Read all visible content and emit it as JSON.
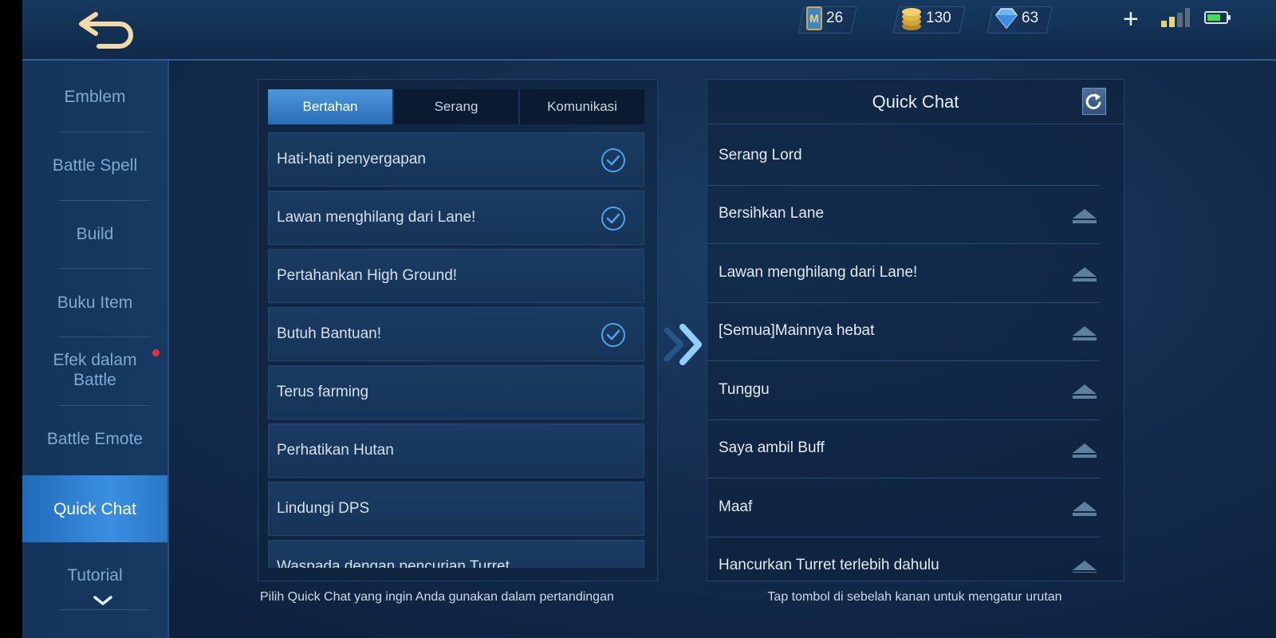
{
  "currencies": [
    {
      "icon": "ticket-icon",
      "value": "26"
    },
    {
      "icon": "gold-coin-icon",
      "value": "130"
    },
    {
      "icon": "diamond-icon",
      "value": "63"
    }
  ],
  "sidebar": {
    "items": [
      {
        "label": "Emblem"
      },
      {
        "label": "Battle Spell"
      },
      {
        "label": "Build"
      },
      {
        "label": "Buku Item"
      },
      {
        "label": "Efek dalam\nBattle",
        "badge": true
      },
      {
        "label": "Battle Emote"
      },
      {
        "label": "Quick Chat",
        "active": true
      },
      {
        "label": "Tutorial"
      }
    ]
  },
  "tabs": [
    {
      "label": "Bertahan",
      "active": true
    },
    {
      "label": "Serang"
    },
    {
      "label": "Komunikasi"
    }
  ],
  "options": [
    {
      "text": "Hati-hati penyergapan",
      "checked": true
    },
    {
      "text": "Lawan menghilang dari Lane!",
      "checked": true
    },
    {
      "text": "Pertahankan High Ground!",
      "checked": false
    },
    {
      "text": "Butuh Bantuan!",
      "checked": true
    },
    {
      "text": "Terus farming",
      "checked": false
    },
    {
      "text": "Perhatikan Hutan",
      "checked": false
    },
    {
      "text": "Lindungi DPS",
      "checked": false
    },
    {
      "text": "Waspada dengan pencurian Turret",
      "checked": false
    }
  ],
  "options_hint": "Pilih Quick Chat yang ingin Anda gunakan dalam pertandingan",
  "quick_chat": {
    "title": "Quick Chat",
    "items": [
      {
        "text": "Serang Lord"
      },
      {
        "text": "Bersihkan Lane"
      },
      {
        "text": "Lawan menghilang dari Lane!"
      },
      {
        "text": "[Semua]Mainnya hebat"
      },
      {
        "text": "Tunggu"
      },
      {
        "text": "Saya ambil Buff"
      },
      {
        "text": "Maaf"
      },
      {
        "text": "Hancurkan Turret terlebih dahulu"
      }
    ],
    "hint": "Tap tombol di sebelah kanan untuk mengatur urutan"
  },
  "colors": {
    "accent": "#3b8fe0",
    "check": "#4ea3e8",
    "badge": "#f02d3a",
    "battery": "#3ee04b"
  }
}
